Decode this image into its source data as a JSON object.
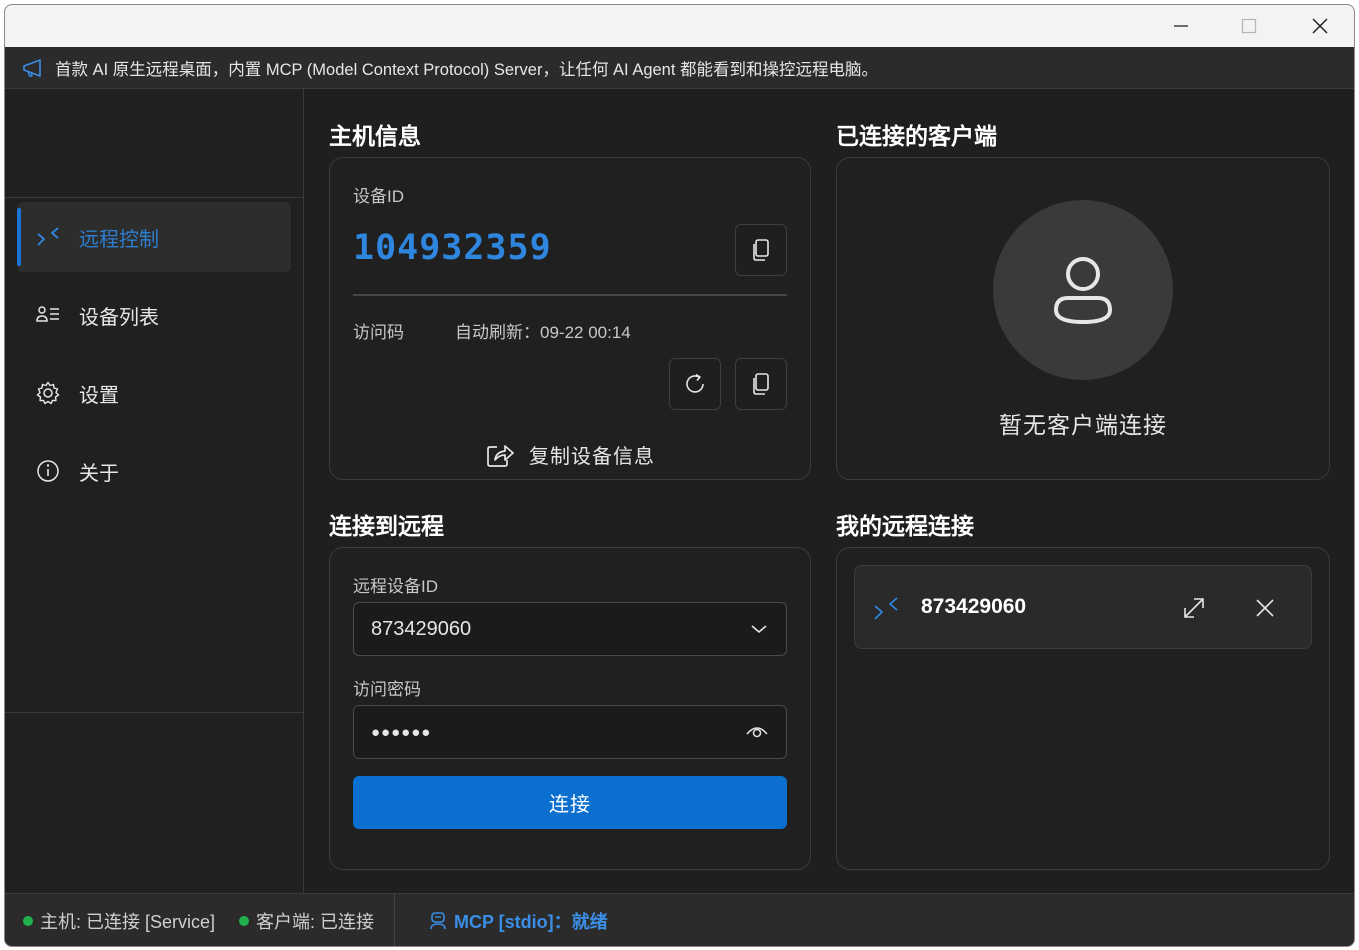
{
  "window": {
    "controls": {
      "minimize": "minimize",
      "maximize": "maximize",
      "close": "close"
    }
  },
  "banner": {
    "icon": "megaphone-icon",
    "text": "首款 AI 原生远程桌面，内置 MCP (Model Context Protocol) Server，让任何 AI Agent 都能看到和操控远程电脑。"
  },
  "sidebar": {
    "items": [
      {
        "label": "远程控制",
        "icon": "remote-control-icon",
        "active": true
      },
      {
        "label": "设备列表",
        "icon": "device-list-icon",
        "active": false
      },
      {
        "label": "设置",
        "icon": "gear-icon",
        "active": false
      },
      {
        "label": "关于",
        "icon": "info-icon",
        "active": false
      }
    ]
  },
  "host_info": {
    "title": "主机信息",
    "device_id_label": "设备ID",
    "device_id": "104932359",
    "access_code_label": "访问码",
    "auto_refresh": "自动刷新：09-22 00:14",
    "copy_device_info": "复制设备信息"
  },
  "clients": {
    "title": "已连接的客户端",
    "empty_text": "暂无客户端连接"
  },
  "connect": {
    "title": "连接到远程",
    "remote_id_label": "远程设备ID",
    "remote_id_value": "873429060",
    "password_label": "访问密码",
    "password_value": "●●●●●●",
    "connect_button": "连接"
  },
  "my_connections": {
    "title": "我的远程连接",
    "items": [
      {
        "id": "873429060"
      }
    ]
  },
  "status": {
    "host": "主机: 已连接 [Service]",
    "client": "客户端: 已连接",
    "mcp": "MCP [stdio]：就绪",
    "ok_color": "#22b14c",
    "accent_color": "#0a6fcf"
  }
}
